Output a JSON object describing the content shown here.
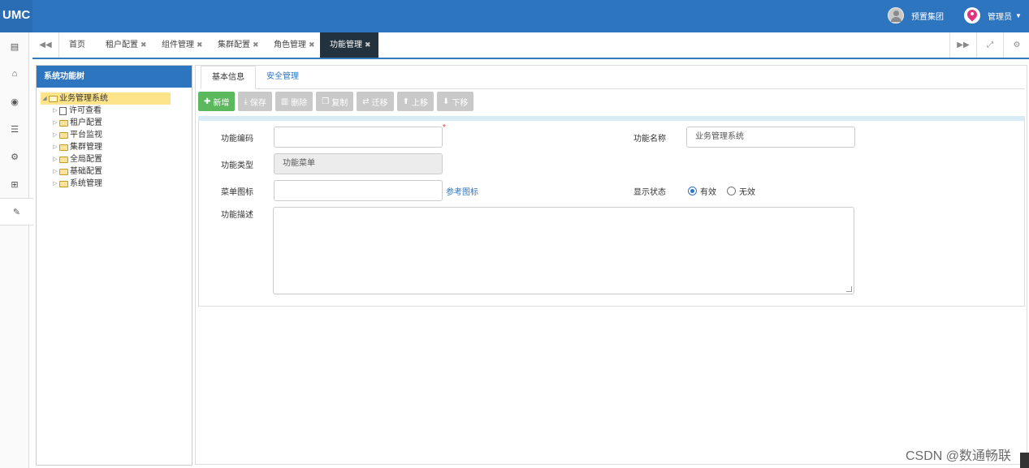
{
  "app": {
    "brand": "UMC"
  },
  "header": {
    "org_label": "预置集团",
    "admin_label": "管理员",
    "caret_icon": "caret-down-icon"
  },
  "rail": {
    "items": [
      {
        "icon": "id-card-icon",
        "glyph": "▤"
      },
      {
        "icon": "bank-icon",
        "glyph": "🏛"
      },
      {
        "icon": "eye-icon",
        "glyph": "◉"
      },
      {
        "icon": "list-icon",
        "glyph": "☰"
      },
      {
        "icon": "gear-icon",
        "glyph": "⚙"
      },
      {
        "icon": "sitemap-icon",
        "glyph": "⊞"
      },
      {
        "icon": "wrench-icon",
        "glyph": "✎"
      }
    ]
  },
  "tabs": {
    "items": [
      {
        "label": "首页",
        "closable": false
      },
      {
        "label": "租户配置",
        "closable": true
      },
      {
        "label": "组件管理",
        "closable": true
      },
      {
        "label": "集群配置",
        "closable": true
      },
      {
        "label": "角色管理",
        "closable": true
      },
      {
        "label": "功能管理",
        "closable": true,
        "active": true
      }
    ],
    "close_glyph": "✖"
  },
  "tree": {
    "title": "系统功能树",
    "root": "业务管理系统",
    "children": [
      "许可查看",
      "租户配置",
      "平台监视",
      "集群管理",
      "全局配置",
      "基础配置",
      "系统管理"
    ]
  },
  "subtabs": [
    "基本信息",
    "安全管理"
  ],
  "toolbar": {
    "add": "新增",
    "save": "保存",
    "delete": "删除",
    "copy": "复制",
    "migrate": "迁移",
    "move_up": "上移",
    "move_down": "下移"
  },
  "form": {
    "code_label": "功能编码",
    "code_value": "",
    "required_mark": "*",
    "name_label": "功能名称",
    "name_value": "业务管理系统",
    "type_label": "功能类型",
    "type_value": "功能菜单",
    "icon_label": "菜单图标",
    "icon_value": "",
    "ref_icon_link": "参考图标",
    "status_label": "显示状态",
    "status_options": [
      "有效",
      "无效"
    ],
    "status_selected": "有效",
    "desc_label": "功能描述",
    "desc_value": ""
  },
  "watermark": "CSDN @数通畅联",
  "colors": {
    "header": "#2e75c0",
    "success": "#5cb85c",
    "link": "#2e75c0",
    "tab_active": "#22323f"
  }
}
